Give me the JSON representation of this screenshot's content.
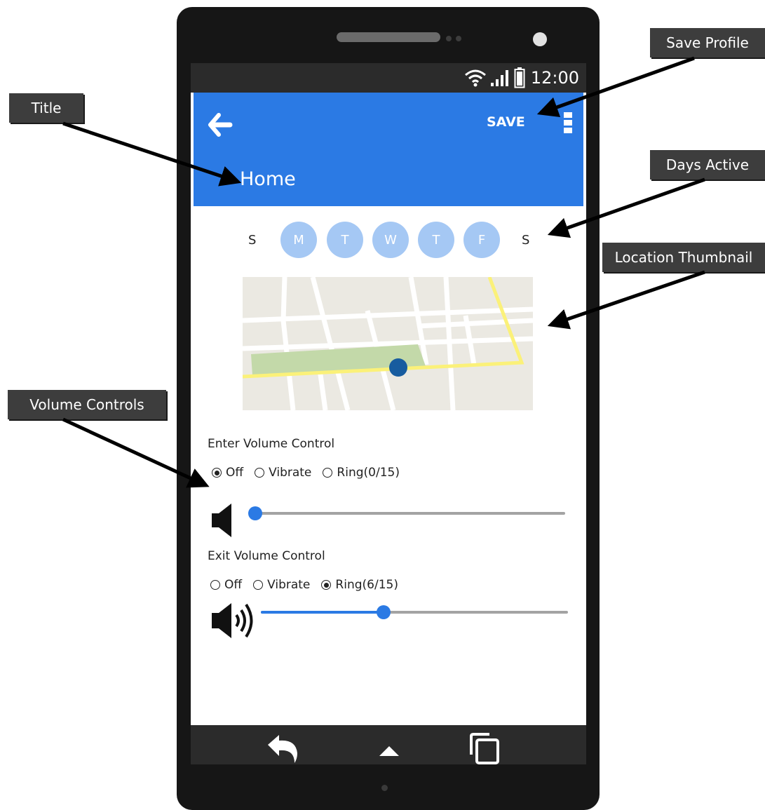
{
  "callouts": {
    "title": "Title",
    "save_profile": "Save Profile",
    "days_active": "Days Active",
    "location_thumbnail": "Location Thumbnail",
    "volume_controls": "Volume Controls"
  },
  "status_bar": {
    "time": "12:00",
    "icons": [
      "wifi-icon",
      "signal-icon",
      "battery-icon"
    ]
  },
  "app_bar": {
    "title": "Home",
    "save_label": "SAVE",
    "back_icon": "arrow-left-icon",
    "menu_icon": "more-vertical-icon"
  },
  "days": {
    "items": [
      {
        "label": "S",
        "active": false
      },
      {
        "label": "M",
        "active": true
      },
      {
        "label": "T",
        "active": true
      },
      {
        "label": "W",
        "active": true
      },
      {
        "label": "T",
        "active": true
      },
      {
        "label": "F",
        "active": true
      },
      {
        "label": "S",
        "active": false
      }
    ]
  },
  "enter_volume": {
    "label": "Enter Volume Control",
    "options": [
      "Off",
      "Vibrate",
      "Ring"
    ],
    "selected": "Off",
    "ring_level_text": "(0/15)",
    "level": 0,
    "max": 15,
    "icon": "speaker-muted-icon"
  },
  "exit_volume": {
    "label": "Exit Volume Control",
    "options": [
      "Off",
      "Vibrate",
      "Ring"
    ],
    "selected": "Ring",
    "ring_level_text": "(6/15)",
    "level": 6,
    "max": 15,
    "icon": "speaker-loud-icon"
  },
  "nav_bar": {
    "icons": [
      "back-icon",
      "home-icon",
      "recent-apps-icon"
    ]
  },
  "colors": {
    "accent": "#2b7ae4",
    "day_active": "#a5c8f4",
    "callout_bg": "#3d3d3d"
  }
}
